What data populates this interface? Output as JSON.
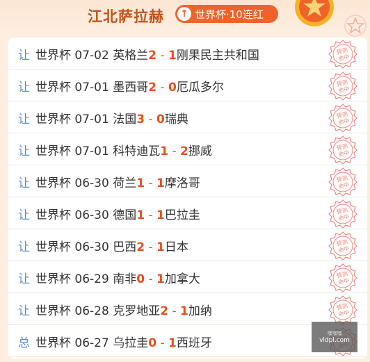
{
  "header": {
    "title": "江北萨拉赫",
    "streak_label": "世界杯·10连红",
    "streak_icon": "arrow-up-icon"
  },
  "stamp_text": [
    "预测",
    "命中"
  ],
  "colors": {
    "accent": "#f0622a",
    "score": "#e8501e",
    "tag": "#5b8fd6",
    "title": "#c2541b"
  },
  "matches": [
    {
      "tag": "让",
      "league": "世界杯",
      "date": "07-02",
      "home": "英格兰",
      "home_score": "2",
      "away_score": "1",
      "away": "刚果民主共和国"
    },
    {
      "tag": "让",
      "league": "世界杯",
      "date": "07-01",
      "home": "墨西哥",
      "home_score": "2",
      "away_score": "0",
      "away": "厄瓜多尔"
    },
    {
      "tag": "让",
      "league": "世界杯",
      "date": "07-01",
      "home": "法国",
      "home_score": "3",
      "away_score": "0",
      "away": "瑞典"
    },
    {
      "tag": "让",
      "league": "世界杯",
      "date": "07-01",
      "home": "科特迪瓦",
      "home_score": "1",
      "away_score": "2",
      "away": "挪威"
    },
    {
      "tag": "让",
      "league": "世界杯",
      "date": "06-30",
      "home": "荷兰",
      "home_score": "1",
      "away_score": "1",
      "away": "摩洛哥"
    },
    {
      "tag": "让",
      "league": "世界杯",
      "date": "06-30",
      "home": "德国",
      "home_score": "1",
      "away_score": "1",
      "away": "巴拉圭"
    },
    {
      "tag": "让",
      "league": "世界杯",
      "date": "06-30",
      "home": "巴西",
      "home_score": "2",
      "away_score": "1",
      "away": "日本"
    },
    {
      "tag": "让",
      "league": "世界杯",
      "date": "06-29",
      "home": "南非",
      "home_score": "0",
      "away_score": "1",
      "away": "加拿大"
    },
    {
      "tag": "让",
      "league": "世界杯",
      "date": "06-28",
      "home": "克罗地亚",
      "home_score": "2",
      "away_score": "1",
      "away": "加纳"
    },
    {
      "tag": "总",
      "league": "世界杯",
      "date": "06-27",
      "home": "乌拉圭",
      "home_score": "0",
      "away_score": "1",
      "away": "西班牙"
    }
  ],
  "watermark": {
    "top": "嘿嘿嘿",
    "site": "vldpl.com"
  }
}
